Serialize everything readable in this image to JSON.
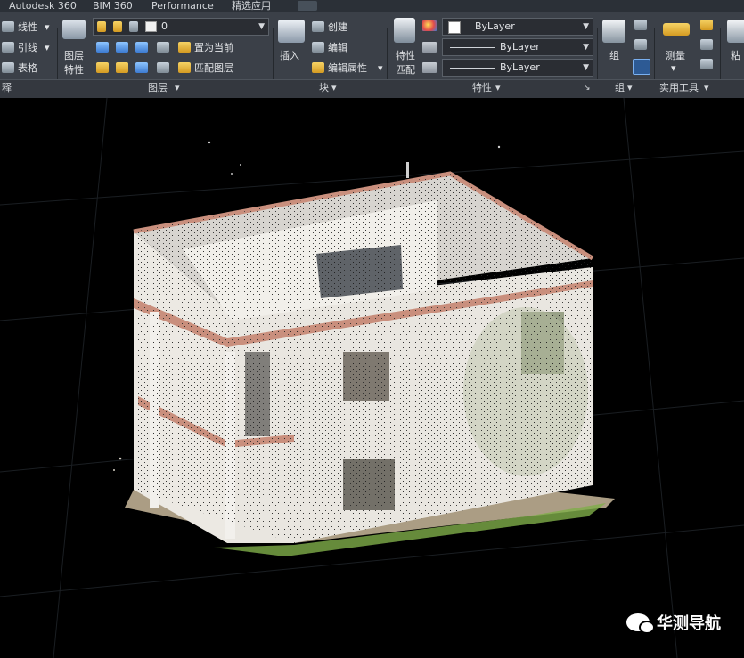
{
  "tabs": {
    "autodesk360": "Autodesk 360",
    "bim360": "BIM 360",
    "performance": "Performance",
    "featured": "精选应用"
  },
  "ribbon": {
    "annotation": {
      "linear": "线性",
      "leader": "引线",
      "table": "表格",
      "panel_label": "释"
    },
    "layers": {
      "layer_props_line1": "图层",
      "layer_props_line2": "特性",
      "layer_value": "0",
      "set_current": "置为当前",
      "match_layer": "匹配图层",
      "panel_label": "图层"
    },
    "block": {
      "insert": "插入",
      "create": "创建",
      "edit": "编辑",
      "edit_attributes": "编辑属性",
      "panel_label": "块"
    },
    "properties": {
      "match_line1": "特性",
      "match_line2": "匹配",
      "color_value": "ByLayer",
      "lineweight_value": "ByLayer",
      "linetype_value": "ByLayer",
      "panel_label": "特性"
    },
    "groups": {
      "group": "组",
      "panel_label": "组"
    },
    "utilities": {
      "measure": "测量",
      "panel_label": "实用工具"
    },
    "clipboard": {
      "paste": "粘"
    }
  },
  "watermark": {
    "text": "华测导航"
  },
  "colors": {
    "ribbon_bg": "#3b4048",
    "tab_bar_bg": "#2b3037",
    "viewport_bg": "#000000",
    "facade": "#e6e3dd",
    "cornice": "#c98f7d",
    "vegetation": "#7fae4a"
  }
}
